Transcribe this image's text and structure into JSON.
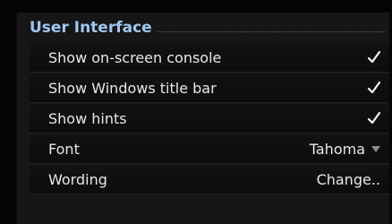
{
  "section": {
    "title": "User Interface"
  },
  "rows": [
    {
      "label": "Show on-screen console",
      "checked": true
    },
    {
      "label": "Show Windows title bar",
      "checked": true
    },
    {
      "label": "Show hints",
      "checked": true
    },
    {
      "label": "Font",
      "value": "Tahoma",
      "control": "dropdown"
    },
    {
      "label": "Wording",
      "value": "Change..",
      "control": "button"
    }
  ],
  "icons": {
    "check": "checkmark-icon",
    "dropdown": "triangle-down-icon"
  },
  "colors": {
    "section_title": "#9ec7ef",
    "text": "#e8e8e8",
    "background": "#161616"
  }
}
